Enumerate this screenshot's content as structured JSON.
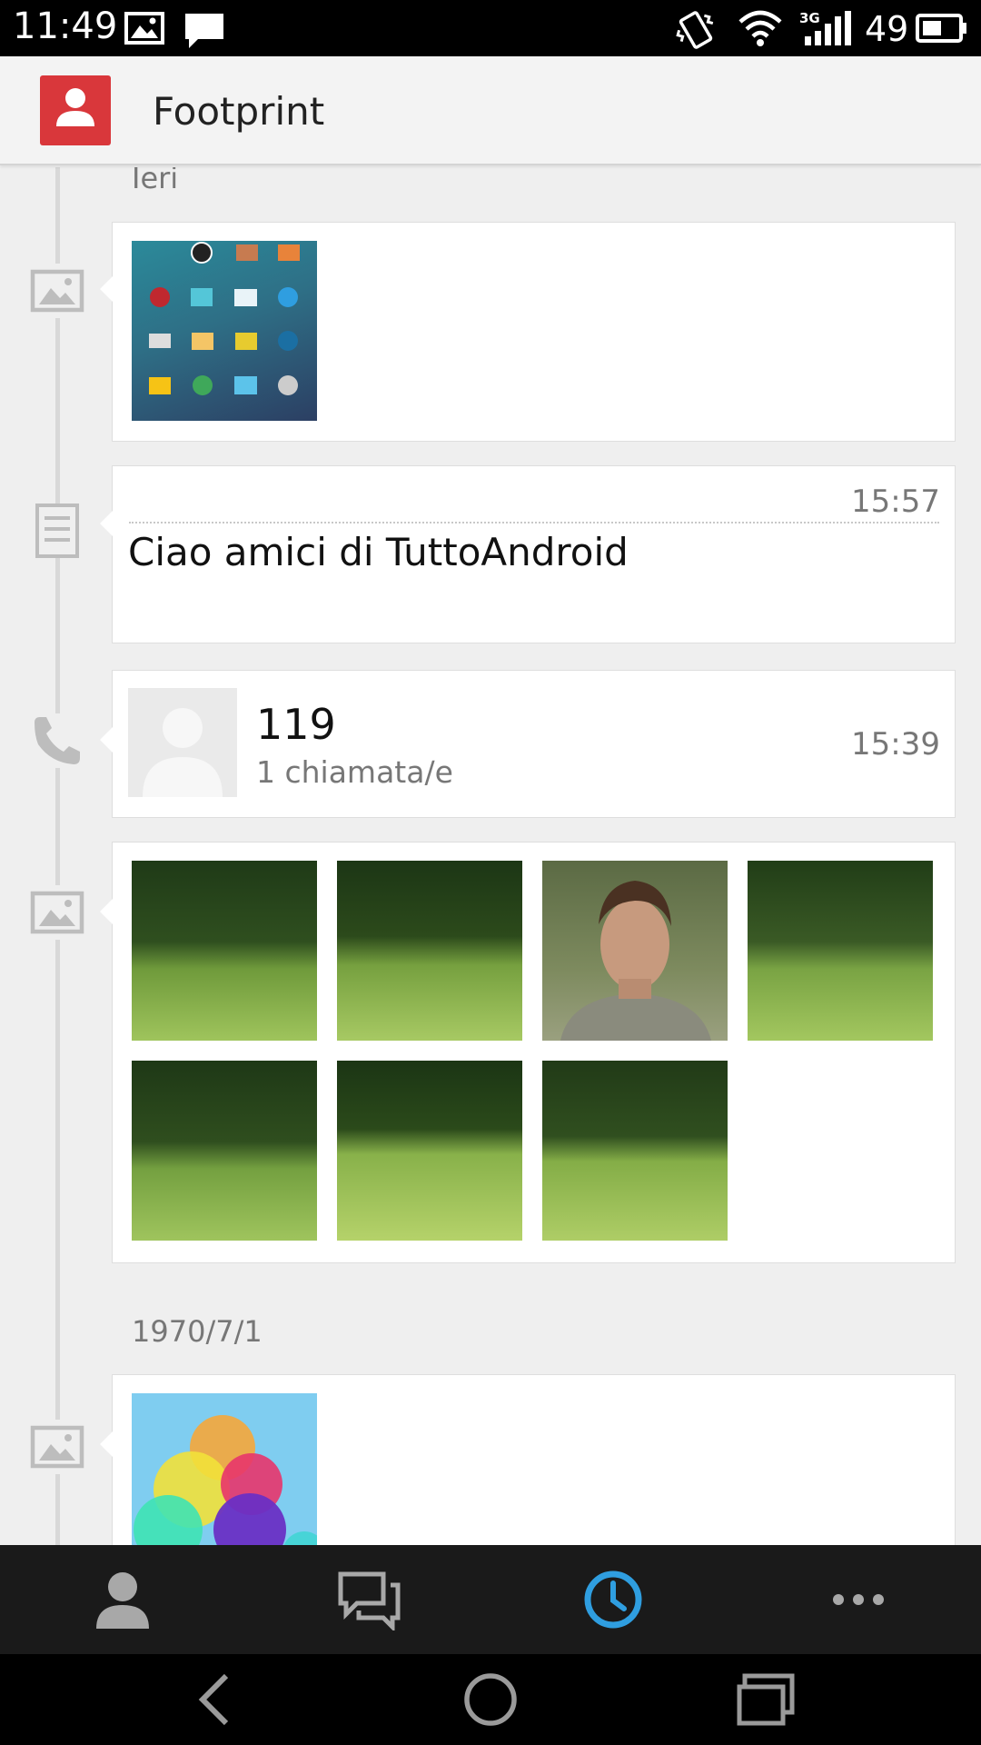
{
  "status_bar": {
    "time": "11:49",
    "battery_level": "49",
    "network": "3G"
  },
  "app_bar": {
    "title": "Footprint"
  },
  "timeline": {
    "groups": [
      {
        "date": "Ieri",
        "entries": [
          {
            "type": "photos",
            "icon": "image-icon",
            "photo_count": 1
          },
          {
            "type": "note",
            "icon": "note-icon",
            "time": "15:57",
            "text": "Ciao amici di TuttoAndroid"
          },
          {
            "type": "call",
            "icon": "phone-icon",
            "number": "119",
            "detail": "1 chiamata/e",
            "time": "15:39"
          },
          {
            "type": "photos",
            "icon": "image-icon",
            "photo_count": 7
          }
        ]
      },
      {
        "date": "1970/7/1",
        "entries": [
          {
            "type": "photos",
            "icon": "image-icon",
            "photo_count": 1
          }
        ]
      }
    ]
  },
  "bottom_tabs": [
    {
      "name": "contacts",
      "icon": "person-icon",
      "active": false
    },
    {
      "name": "messages",
      "icon": "chat-icon",
      "active": false
    },
    {
      "name": "footprint",
      "icon": "clock-icon",
      "active": true
    },
    {
      "name": "more",
      "icon": "more-dots-icon",
      "active": false
    }
  ],
  "colors": {
    "accent": "#2f9ee0",
    "app_icon": "#d9373b",
    "background": "#efefef",
    "card": "#ffffff",
    "bottom_bar": "#1a1a1a"
  }
}
